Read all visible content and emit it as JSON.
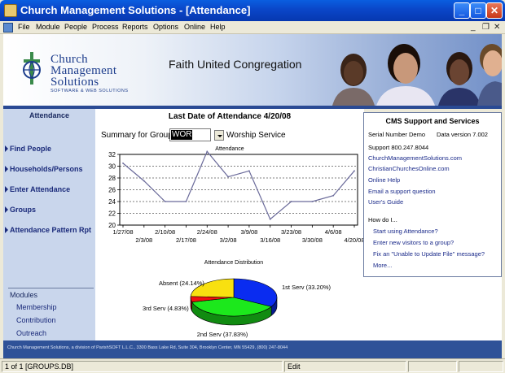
{
  "window": {
    "title": "Church Management Solutions - [Attendance]",
    "minimize": "_",
    "maximize": "□",
    "close": "✕"
  },
  "menu": [
    "File",
    "Module",
    "People",
    "Process",
    "Reports",
    "Options",
    "Online",
    "Help"
  ],
  "mdi_controls": {
    "minimize": "_",
    "restore": "❐",
    "close": "✕"
  },
  "banner": {
    "logo_line1": "Church",
    "logo_line2": "Management",
    "logo_line3": "Solutions",
    "logo_sub": "SOFTWARE & WEB SOLUTIONS",
    "congregation": "Faith United Congregation"
  },
  "sidebar": {
    "title": "Attendance",
    "items": [
      "Find People",
      "Households/Persons",
      "Enter Attendance",
      "Groups",
      "Attendance Pattern Rpt"
    ],
    "modules_title": "Modules",
    "modules": [
      "Membership",
      "Contribution",
      "Outreach"
    ]
  },
  "main": {
    "heading": "Last Date of Attendance 4/20/08",
    "summary_label": "Summary for Group",
    "group_code": "WOR",
    "group_name": "Worship Service"
  },
  "chart_data": [
    {
      "type": "line",
      "title": "Attendance",
      "x": [
        "1/27/08",
        "2/3/08",
        "2/10/08",
        "2/17/08",
        "2/24/08",
        "3/2/08",
        "3/9/08",
        "3/16/08",
        "3/23/08",
        "3/30/08",
        "4/6/08",
        "4/20/08"
      ],
      "values": [
        30.5,
        27.5,
        24,
        24,
        32.5,
        28.2,
        29.2,
        21,
        24,
        24,
        25,
        29.2
      ],
      "ylim": [
        20,
        32
      ],
      "yticks": [
        20,
        22,
        24,
        26,
        28,
        30,
        32
      ],
      "grid": "dashed horizontal",
      "color": "#6a6a9a"
    },
    {
      "type": "pie",
      "title": "Attendance Distribution",
      "categories": [
        "1st Serv",
        "2nd Serv",
        "3rd Serv",
        "Absent"
      ],
      "values": [
        33.2,
        37.83,
        4.83,
        24.14
      ],
      "labels": [
        "1st Serv (33.20%)",
        "2nd Serv (37.83%)",
        "3rd Serv (4.83%)",
        "Absent (24.14%)"
      ],
      "colors": [
        "#0a2cf0",
        "#1ce81c",
        "#f01010",
        "#f8e010"
      ]
    }
  ],
  "support": {
    "title": "CMS Support and Services",
    "serial": "Serial Number Demo",
    "data_version": "Data version  7.002",
    "phone": "Support 800.247.8044",
    "links": [
      "ChurchManagementSolutions.com",
      "ChristianChurchesOnline.com",
      "Online Help",
      "Email a support question",
      "User's Guide"
    ],
    "how_do_i": "How do I...",
    "howto": [
      "Start using Attendance?",
      "Enter new visitors to a group?",
      "Fix an \"Unable to Update File\" message?",
      "More..."
    ]
  },
  "footer": "Church Management Solutions, a division of ParishSOFT L.L.C., 3300 Bass Lake Rd, Suite 304, Brooklyn Center, MN 55429, (800) 247-8044",
  "status": {
    "record": "1 of 1 [GROUPS.DB]",
    "mode": "Edit"
  }
}
